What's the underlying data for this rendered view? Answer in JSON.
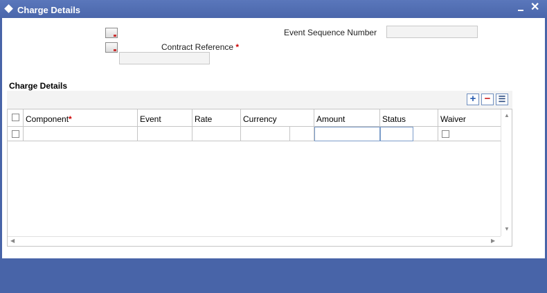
{
  "window": {
    "title": "Charge Details",
    "minimize_symbol": "▬",
    "close_symbol": "✕"
  },
  "form": {
    "event_sequence_label": "Event Sequence Number",
    "event_sequence_value": "",
    "contract_reference_label": "Contract Reference",
    "contract_reference_value": "",
    "required_marker": "*"
  },
  "section": {
    "title": "Charge Details"
  },
  "toolbar": {
    "add_symbol": "+",
    "remove_symbol": "−",
    "view_symbol": "☰"
  },
  "table": {
    "columns": [
      "Component",
      "Event",
      "Rate",
      "Currency",
      "Amount",
      "Status",
      "Waiver"
    ],
    "rows": [
      {
        "component": "",
        "event": "",
        "rate": "",
        "currency": "",
        "amount": "",
        "status": "",
        "waiver": false
      }
    ]
  },
  "colors": {
    "frame": "#4864a8",
    "title_bar": "#4a66ab",
    "required": "#cc0000",
    "active_cell_border": "#7b9cc9"
  }
}
